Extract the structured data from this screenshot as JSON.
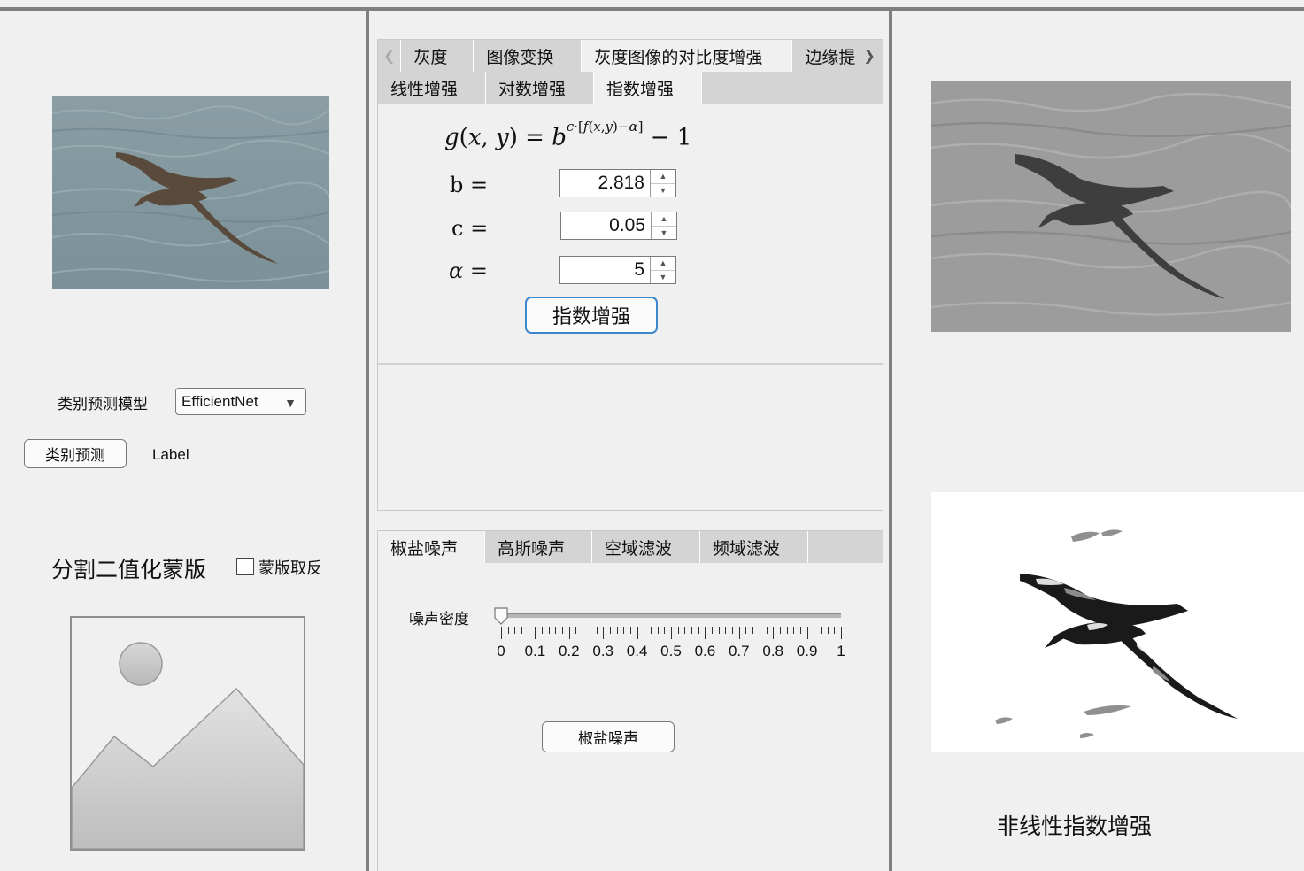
{
  "left_panel": {
    "model_label": "类别预测模型",
    "model_select_value": "EfficientNet",
    "predict_button": "类别预测",
    "prediction_label": "Label",
    "mask_title": "分割二值化蒙版",
    "invert_checkbox_label": "蒙版取反",
    "invert_checked": false
  },
  "enhance_panel": {
    "outer_tabs": [
      "灰度",
      "图像变换",
      "灰度图像的对比度增强",
      "边缘提"
    ],
    "outer_active": "灰度图像的对比度增强",
    "inner_tabs": [
      "线性增强",
      "对数增强",
      "指数增强"
    ],
    "inner_active": "指数增强",
    "formula": "g(x, y) = b^(c·[f(x,y)−α]) − 1",
    "params": [
      {
        "label": "b =",
        "value": "2.818"
      },
      {
        "label": "c =",
        "value": "0.05"
      },
      {
        "label": "α =",
        "value": "5"
      }
    ],
    "apply_button": "指数增强"
  },
  "noise_panel": {
    "tabs": [
      "椒盐噪声",
      "高斯噪声",
      "空域滤波",
      "频域滤波"
    ],
    "active": "椒盐噪声",
    "slider_label": "噪声密度",
    "slider_value": 0,
    "slider_ticks": [
      "0",
      "0.1",
      "0.2",
      "0.3",
      "0.4",
      "0.5",
      "0.6",
      "0.7",
      "0.8",
      "0.9",
      "1"
    ],
    "apply_button": "椒盐噪声"
  },
  "right_panel": {
    "caption": "非线性指数增强"
  },
  "colors": {
    "accent_border": "#3d87cf",
    "frame": "#7f7f7f",
    "tab_bar": "#d4d4d4"
  }
}
